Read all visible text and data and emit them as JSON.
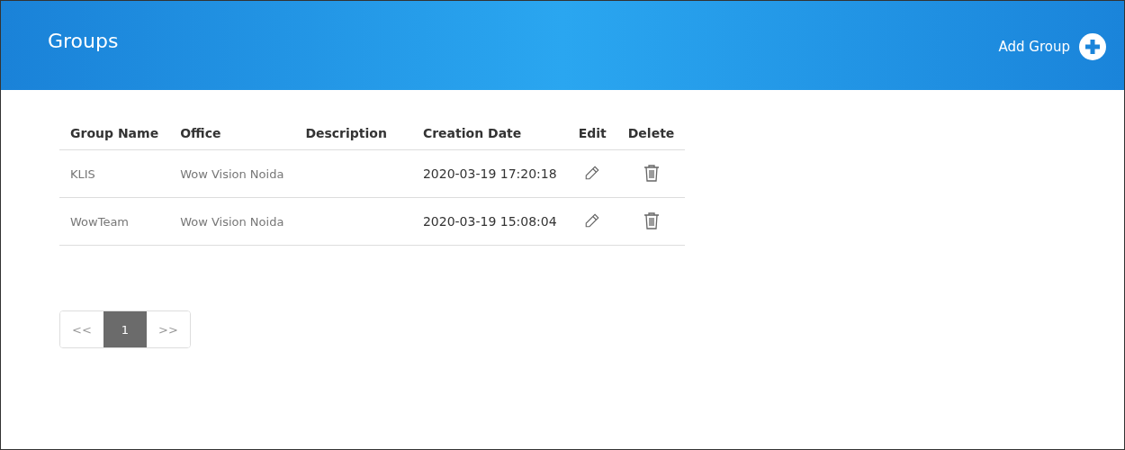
{
  "header": {
    "title": "Groups",
    "add_button": "Add Group"
  },
  "table": {
    "columns": [
      "Group Name",
      "Office",
      "Description",
      "Creation Date",
      "Edit",
      "Delete"
    ],
    "rows": [
      {
        "group_name": "KLIS",
        "office": "Wow Vision Noida",
        "description": "",
        "creation_date": "2020-03-19 17:20:18"
      },
      {
        "group_name": "WowTeam",
        "office": "Wow Vision Noida",
        "description": "",
        "creation_date": "2020-03-19 15:08:04"
      }
    ]
  },
  "pagination": {
    "prev": "<<",
    "next": ">>",
    "pages": [
      {
        "label": "1",
        "selected": true
      }
    ]
  }
}
